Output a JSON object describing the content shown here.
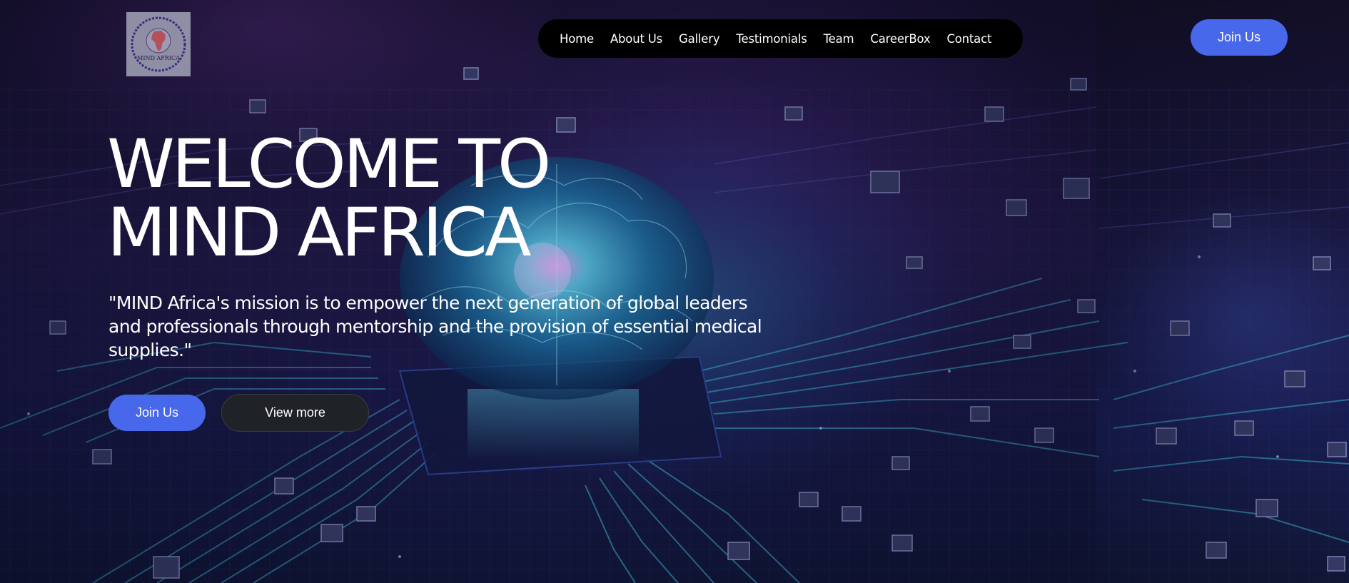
{
  "logo": {
    "text": "MIND AFRICA",
    "alt": "MIND Africa logo"
  },
  "nav": {
    "items": [
      {
        "label": "Home"
      },
      {
        "label": "About Us"
      },
      {
        "label": "Gallery"
      },
      {
        "label": "Testimonials"
      },
      {
        "label": "Team"
      },
      {
        "label": "CareerBox"
      },
      {
        "label": "Contact"
      }
    ]
  },
  "header": {
    "join_label": "Join Us"
  },
  "hero": {
    "title_line1": "WELCOME TO",
    "title_line2": "MIND AFRICA",
    "mission": "\"MIND Africa's mission is to empower the next generation of global leaders and professionals through mentorship and the provision of essential medical supplies.\"",
    "join_label": "Join Us",
    "view_more_label": "View more"
  },
  "colors": {
    "accent": "#4868ec",
    "nav_bg": "#000000",
    "secondary_button": "#1f2227",
    "text": "#ffffff"
  }
}
